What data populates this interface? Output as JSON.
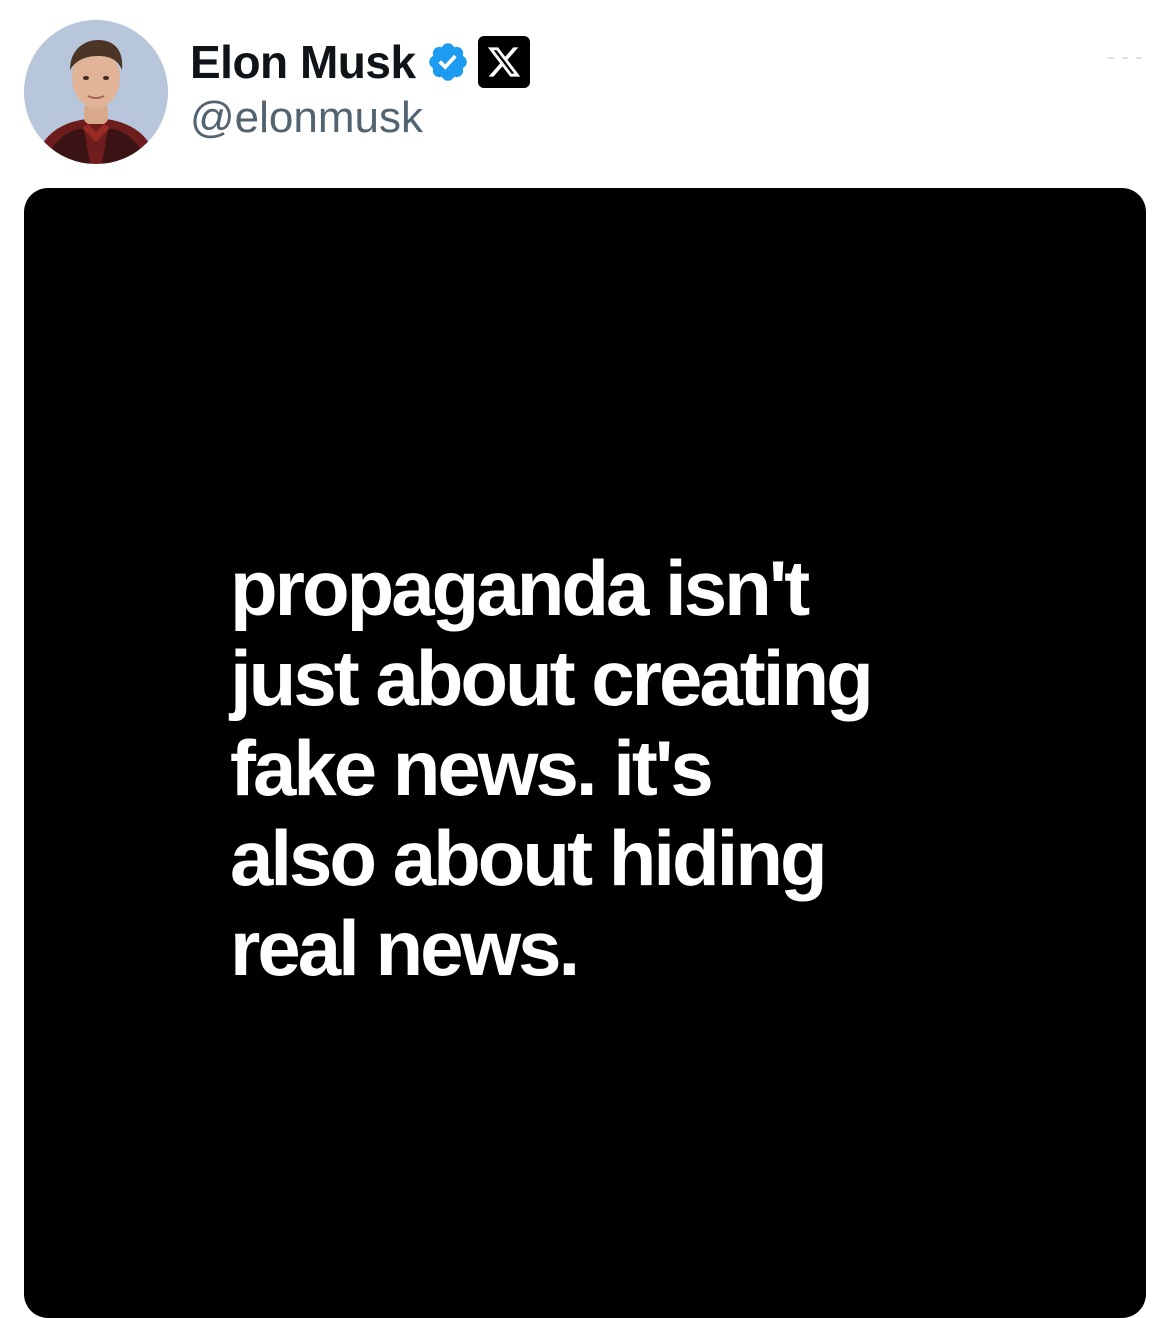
{
  "post": {
    "author": {
      "display_name": "Elon Musk",
      "handle": "@elonmusk",
      "verified": true,
      "verified_badge_icon": "verified-checkmark-icon",
      "verified_color": "#1d9bf0",
      "affiliation_icon": "x-logo-icon"
    },
    "media": {
      "background_color": "#000000",
      "text_color": "#ffffff",
      "text": "propaganda isn't\njust about creating\nfake news. it's\nalso about hiding\nreal news."
    }
  }
}
